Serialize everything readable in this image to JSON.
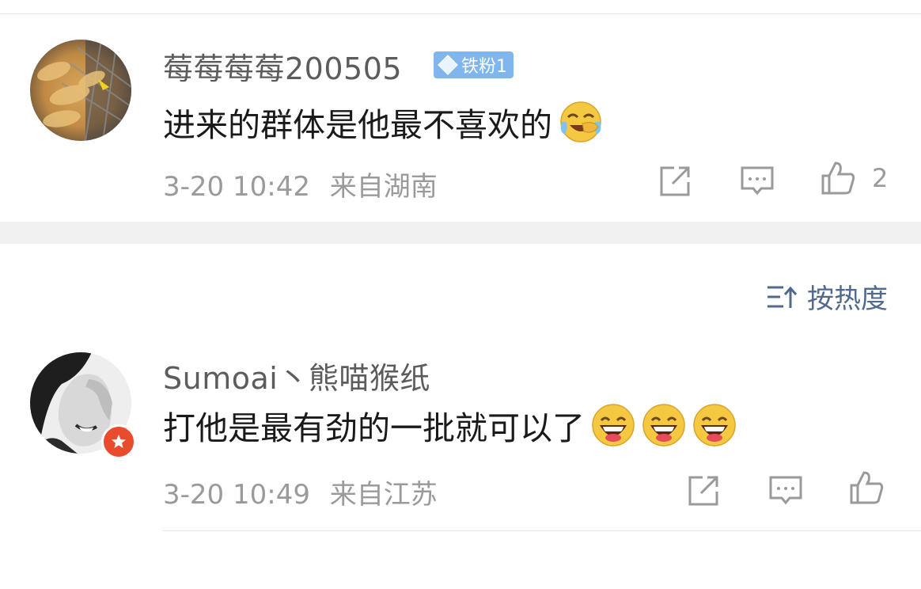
{
  "comments": [
    {
      "username": "莓莓莓莓200505",
      "badge": {
        "icon": "diamond-icon",
        "label": "铁粉1",
        "color": "#7fb6ee"
      },
      "text": "进来的群体是他最不喜欢的",
      "emoji": [
        "laugh-cry-emoji"
      ],
      "time": "3-20 10:42",
      "location": "来自湖南",
      "likes": "2"
    },
    {
      "username": "Sumoai丶熊喵猴纸",
      "text": "打他是最有劲的一批就可以了",
      "emoji": [
        "grin-emoji",
        "grin-emoji",
        "grin-emoji"
      ],
      "time": "3-20 10:49",
      "location": "来自江苏",
      "avatar_badge": {
        "icon": "star-icon",
        "color": "#e94c2c"
      }
    }
  ],
  "sort": {
    "icon": "sort-icon",
    "label": "按热度",
    "color": "#50698f"
  },
  "icons": {
    "share": "share-icon",
    "comment": "comment-icon",
    "like": "thumbs-up-icon"
  }
}
